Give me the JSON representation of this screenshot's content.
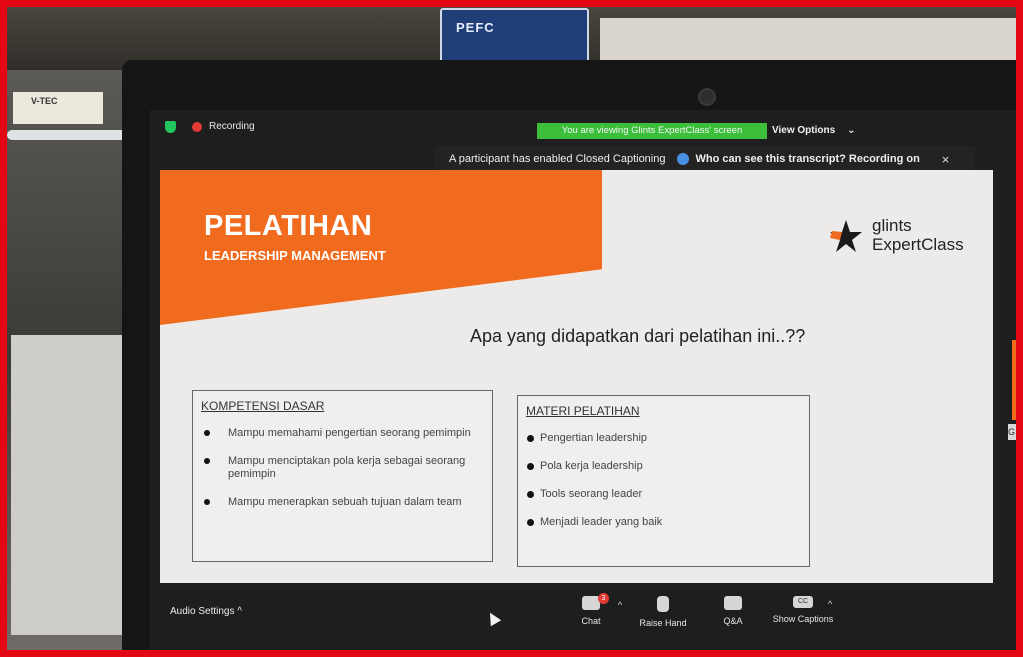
{
  "environment": {
    "box_label": "PEFC",
    "left_label": "V-TEC"
  },
  "zoom": {
    "recording_label": "Recording",
    "viewing_banner": "You are viewing Glints ExpertClass' screen",
    "view_options_label": "View Options",
    "cc_notice": "A participant has enabled Closed Captioning",
    "cc_question": "Who can see this transcript? Recording on",
    "close_symbol": "×",
    "accent_green": "#3bbf3b",
    "recording_red": "#e53935"
  },
  "slide": {
    "title": "PELATIHAN",
    "subtitle": "LEADERSHIP MANAGEMENT",
    "logo_line1": "glints",
    "logo_line2": "ExpertClass",
    "question": "Apa yang didapatkan dari pelatihan ini..??",
    "accent_orange": "#f16b1f",
    "box_kompetensi": {
      "heading": "KOMPETENSI DASAR",
      "items": [
        "Mampu memahami pengertian seorang pemimpin",
        "Mampu menciptakan pola kerja sebagai seorang pemimpin",
        "Mampu menerapkan sebuah tujuan dalam team"
      ]
    },
    "box_materi": {
      "heading": "MATERI PELATIHAN",
      "items": [
        "Pengertian leadership",
        "Pola kerja leadership",
        "Tools seorang leader",
        "Menjadi leader yang baik"
      ]
    }
  },
  "side_tab": "G",
  "toolbar": {
    "audio_settings_label": "Audio Settings",
    "chat_label": "Chat",
    "chat_badge": "3",
    "raise_hand_label": "Raise Hand",
    "qa_label": "Q&A",
    "captions_label": "Show Captions",
    "cc_icon_text": "CC",
    "caret_up": "^"
  }
}
